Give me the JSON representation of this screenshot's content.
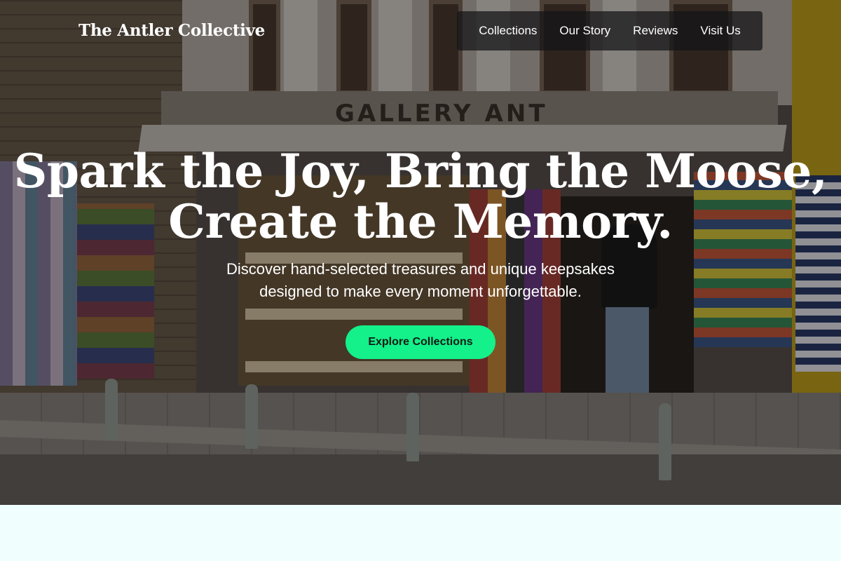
{
  "header": {
    "brand": "The Antler Collective",
    "nav": [
      {
        "label": "Collections"
      },
      {
        "label": "Our Story"
      },
      {
        "label": "Reviews"
      },
      {
        "label": "Visit Us"
      }
    ]
  },
  "hero": {
    "title_line1": "Spark the Joy, Bring the Moose,",
    "title_line2": "Create the Memory.",
    "subtitle_line1": "Discover hand-selected treasures and unique keepsakes",
    "subtitle_line2": "designed to make every moment unforgettable.",
    "cta_label": "Explore Collections",
    "background_sign": "GALLERY ANT"
  },
  "colors": {
    "accent": "#14f08a",
    "nav_bg": "#141416",
    "page_bg": "#f0fffe"
  }
}
